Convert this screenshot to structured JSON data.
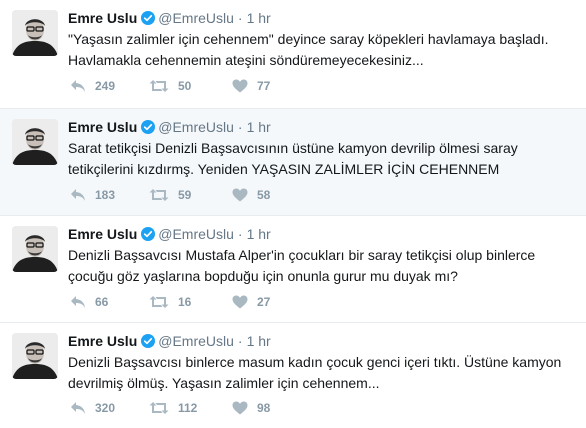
{
  "tweets": [
    {
      "name": "Emre Uslu",
      "handle": "@EmreUslu",
      "dot": "·",
      "time": "1 hr",
      "text": "\"Yaşasın zalimler için cehennem\" deyince saray köpekleri havlamaya başladı.\nHavlamakla cehennemin ateşini söndüremeyecekesiniz...",
      "replies": "249",
      "retweets": "50",
      "likes": "77"
    },
    {
      "name": "Emre Uslu",
      "handle": "@EmreUslu",
      "dot": "·",
      "time": "1 hr",
      "text": "Sarat tetikçisi Denizli Başsavcısının üstüne kamyon devrilip ölmesi saray\ntetikçilerini kızdırmş. Yeniden YAŞASIN ZALİMLER İÇİN CEHENNEM",
      "replies": "183",
      "retweets": "59",
      "likes": "58"
    },
    {
      "name": "Emre Uslu",
      "handle": "@EmreUslu",
      "dot": "·",
      "time": "1 hr",
      "text": "Denizli Başsavcısı Mustafa Alper'in çocukları bir saray tetikçisi olup binlerce\nçocuğu göz yaşlarına bopduğu için  onunla gurur mu duyak mı?",
      "replies": "66",
      "retweets": "16",
      "likes": "27"
    },
    {
      "name": "Emre Uslu",
      "handle": "@EmreUslu",
      "dot": "·",
      "time": "1 hr",
      "text": "Denizli Başsavcısı binlerce masum kadın çocuk genci içeri tıktı. Üstüne kamyon\ndevrilmiş ölmüş. Yaşasın zalimler için cehennem...",
      "replies": "320",
      "retweets": "112",
      "likes": "98"
    }
  ],
  "icons": {
    "verified": "verified-badge-icon",
    "reply": "reply-icon",
    "retweet": "retweet-icon",
    "like": "heart-icon"
  },
  "colors": {
    "verified": "#1da1f2",
    "icon": "#aab8c2",
    "muted": "#657786",
    "text": "#14171a",
    "highlight_bg": "#f5f8fa"
  }
}
